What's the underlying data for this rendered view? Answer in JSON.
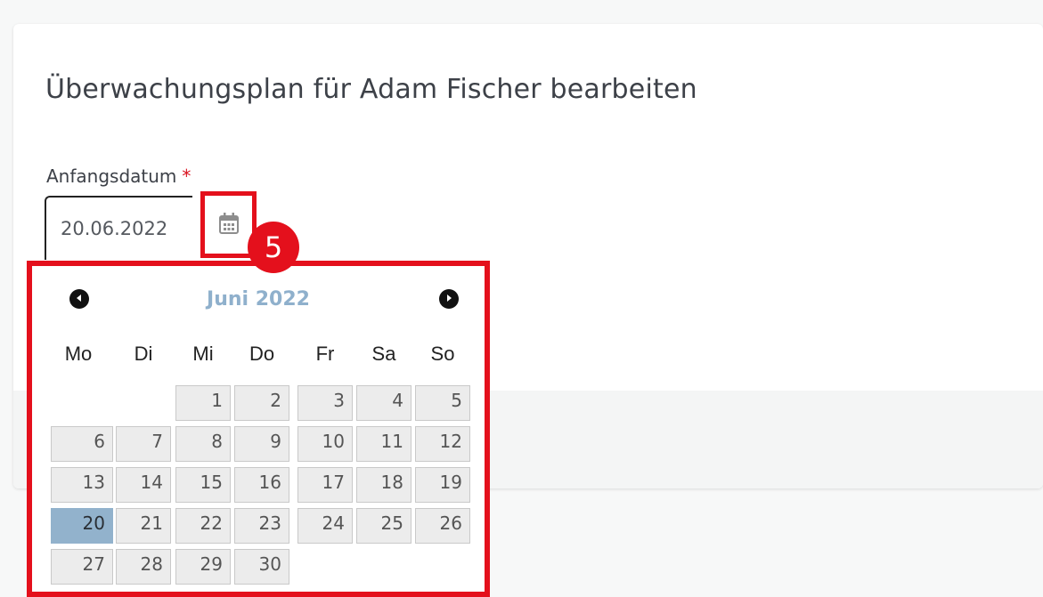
{
  "page": {
    "title": "Überwachungsplan für Adam Fischer bearbeiten"
  },
  "form": {
    "start_date_label": "Anfangsdatum",
    "required_marker": "*",
    "start_date_value": "20.06.2022"
  },
  "annotation": {
    "badge": "5",
    "color": "#e4101c"
  },
  "datepicker": {
    "month_title": "Juni 2022",
    "weekdays": [
      "Mo",
      "Di",
      "Mi",
      "Do",
      "Fr",
      "Sa",
      "So"
    ],
    "days": [
      "1",
      "2",
      "3",
      "4",
      "5",
      "6",
      "7",
      "8",
      "9",
      "10",
      "11",
      "12",
      "13",
      "14",
      "15",
      "16",
      "17",
      "18",
      "19",
      "20",
      "21",
      "22",
      "23",
      "24",
      "25",
      "26",
      "27",
      "28",
      "29",
      "30"
    ],
    "selected_day": "20",
    "icons": {
      "prev": "chevron-left-icon",
      "next": "chevron-right-icon",
      "calendar": "calendar-icon"
    },
    "selected_color": "#92b2cc"
  }
}
